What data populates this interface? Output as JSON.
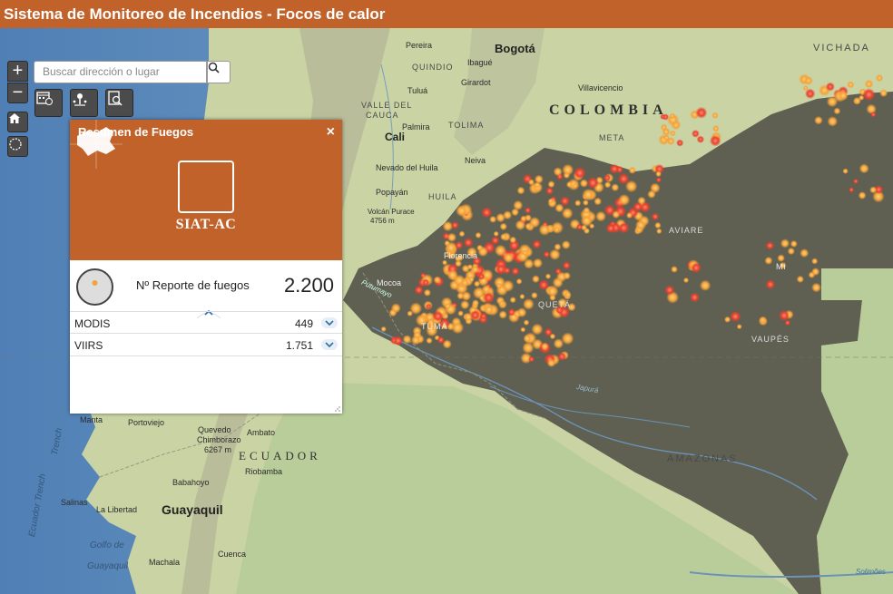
{
  "window": {
    "title": "Sistema de Monitoreo de Incendios - Focos de calor"
  },
  "search": {
    "placeholder": "Buscar dirección o lugar"
  },
  "controls": {
    "zoom_in": "+",
    "zoom_out": "−"
  },
  "panel": {
    "title": "Resumen de Fuegos",
    "close": "×",
    "logo_text": "SIAT-AC",
    "summary_label": "Nº Reporte de fuegos",
    "summary_value": "2.200",
    "rows": [
      {
        "name": "MODIS",
        "value": "449"
      },
      {
        "name": "VIIRS",
        "value": "1.751"
      }
    ]
  },
  "map_labels": {
    "bogota": "Bogotá",
    "colombia": "COLOMBIA",
    "ecuador": "ECUADOR",
    "amazonas": "AMAZONAS",
    "vichada": "VICHADA",
    "meta": "META",
    "guaviare": "AVIARE",
    "caqueta": "QUETÁ",
    "vaupes": "VAUPÉS",
    "huila": "HUILA",
    "tolima": "TOLIMA",
    "valle": "VALLE DEL",
    "cauca_dept": "CAUCA",
    "quindio": "QUINDIO",
    "cauca_city": "Cali",
    "pereira": "Pereira",
    "ibague": "Ibagué",
    "girardot": "Girardot",
    "villavicencio": "Villavicencio",
    "tulua": "Tuluá",
    "palmira": "Palmira",
    "neiva": "Neiva",
    "nevado": "Nevado del Huila",
    "popayan": "Popayán",
    "volcan": "Volcán Purace",
    "volcan_alt": "4756 m",
    "florencia": "Florencia",
    "mocoa": "Mocoa",
    "putumayo_dept": "TUMA",
    "guayaquil": "Guayaquil",
    "manta": "Manta",
    "portoviejo": "Portoviejo",
    "quevedo": "Quevedo",
    "chimborazo": "Chimborazo",
    "chimborazo_alt": "6267 m",
    "ambato": "Ambato",
    "riobamba": "Riobamba",
    "babahoyo": "Babahoyo",
    "salinas": "Salinas",
    "la_libertad": "La Libertad",
    "machala": "Machala",
    "cuenca": "Cuenca",
    "gulf": "Golfo de",
    "gulf2": "Guayaquil",
    "trench": "Ecuador Trench",
    "trench2": "Trench",
    "putumayo_river": "Putumayo",
    "japura": "Japurá",
    "solimoes": "Solimões",
    "dept_n": "Mi"
  },
  "colors": {
    "title_bar": "#c0622a",
    "fire_orange": "#f4a239",
    "fire_red": "#e8412e",
    "ocean": "#7fa6c9",
    "land": "#c9d3a3",
    "dark_region": "#5f5f52"
  }
}
